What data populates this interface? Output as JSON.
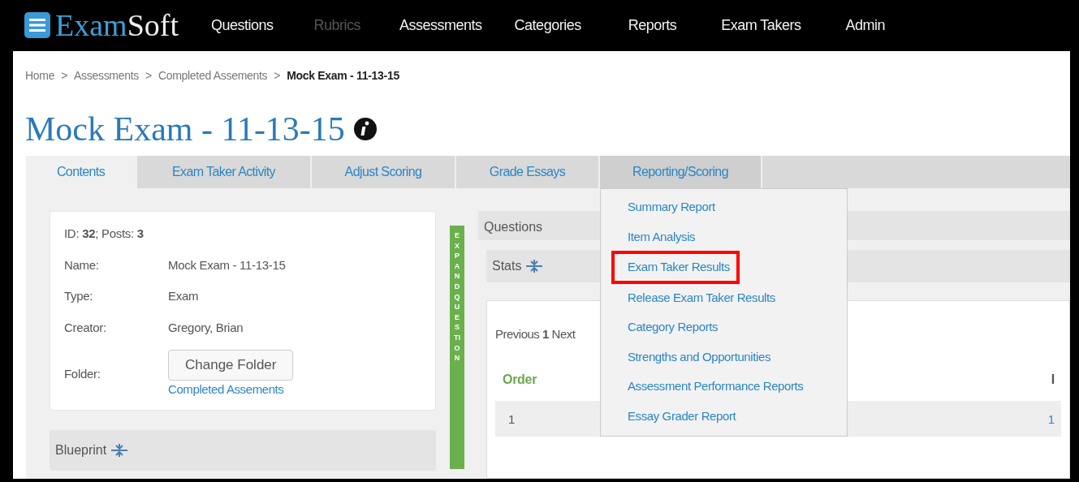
{
  "brand": {
    "part1": "Exam",
    "part2": "Soft"
  },
  "nav": [
    {
      "label": "Questions",
      "disabled": false
    },
    {
      "label": "Rubrics",
      "disabled": true
    },
    {
      "label": "Assessments",
      "disabled": false
    },
    {
      "label": "Categories",
      "disabled": false
    },
    {
      "label": "Reports",
      "disabled": false
    },
    {
      "label": "Exam Takers",
      "disabled": false
    },
    {
      "label": "Admin",
      "disabled": false
    }
  ],
  "breadcrumb": [
    {
      "label": "Home",
      "current": false
    },
    {
      "label": "Assessments",
      "current": false
    },
    {
      "label": "Completed Assements",
      "current": false
    },
    {
      "label": "Mock Exam - 11-13-15",
      "current": true
    }
  ],
  "breadcrumb_separator": ">",
  "title": "Mock Exam - 11-13-15",
  "tabs": [
    {
      "label": "Contents",
      "selected": true,
      "expanded": false
    },
    {
      "label": "Exam Taker Activity",
      "selected": false,
      "expanded": false
    },
    {
      "label": "Adjust Scoring",
      "selected": false,
      "expanded": false
    },
    {
      "label": "Grade Essays",
      "selected": false,
      "expanded": false
    },
    {
      "label": "Reporting/Scoring",
      "selected": false,
      "expanded": true
    }
  ],
  "dropdown": [
    {
      "label": "Summary Report",
      "highlighted": false
    },
    {
      "label": "Item Analysis",
      "highlighted": false
    },
    {
      "label": "Exam Taker Results",
      "highlighted": true
    },
    {
      "label": "Release Exam Taker Results",
      "highlighted": false
    },
    {
      "label": "Category Reports",
      "highlighted": false
    },
    {
      "label": "Strengths and Opportunities",
      "highlighted": false
    },
    {
      "label": "Assessment Performance Reports",
      "highlighted": false
    },
    {
      "label": "Essay Grader Report",
      "highlighted": false
    }
  ],
  "info": {
    "summary": "ID: **32**; Posts: **3**",
    "fields": [
      {
        "label": "Name:",
        "value": "Mock Exam - 11-13-15"
      },
      {
        "label": "Type:",
        "value": "Exam"
      },
      {
        "label": "Creator:",
        "value": "Gregory, Brian"
      }
    ],
    "folder_label": "Folder:",
    "folder_button": "Change Folder",
    "folder_link": "Completed Assements"
  },
  "blueprint": "Blueprint",
  "expand_bar": "EXPAND QUESTION",
  "questions": {
    "title": "Questions",
    "stats": "Stats",
    "pager": "Previous **1** Next",
    "columns": [
      "Order",
      "I"
    ],
    "rows": [
      [
        "1",
        "1"
      ]
    ]
  }
}
